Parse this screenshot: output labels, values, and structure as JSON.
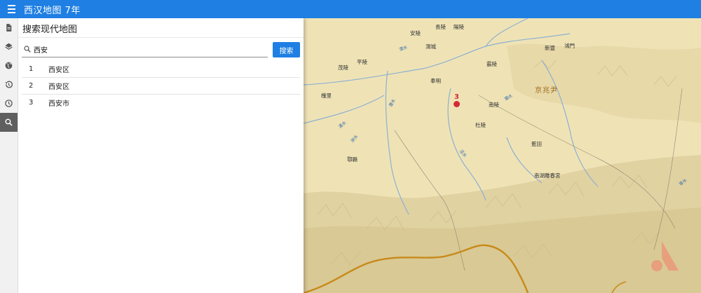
{
  "app": {
    "title": "西汉地图 7年"
  },
  "sidebar": {
    "items": [
      {
        "id": "document",
        "icon": "document-icon"
      },
      {
        "id": "layers",
        "icon": "layers-icon"
      },
      {
        "id": "globe",
        "icon": "globe-icon"
      },
      {
        "id": "history",
        "icon": "history-icon"
      },
      {
        "id": "clock",
        "icon": "clock-icon"
      },
      {
        "id": "search",
        "icon": "search-icon",
        "active": true
      }
    ]
  },
  "panel": {
    "title": "搜索现代地图",
    "search": {
      "value": "西安",
      "button_label": "搜索"
    },
    "results": [
      {
        "index": "1",
        "name": "西安区"
      },
      {
        "index": "2",
        "name": "西安区"
      },
      {
        "index": "3",
        "name": "西安市"
      }
    ]
  },
  "map": {
    "marker": {
      "label": "3",
      "color": "#d42a35"
    },
    "prefecture_label": "京兆尹",
    "place_labels": [
      "長陵",
      "陽陵",
      "安陵",
      "渭城",
      "新豐",
      "鴻門",
      "茂陵",
      "平陵",
      "霸陵",
      "槐里",
      "奉明",
      "南陵",
      "杜陵",
      "藍田",
      "鄠縣",
      "南湖離春宮"
    ],
    "river_labels": [
      "渭水",
      "灞水",
      "灃水",
      "潏水",
      "澇水",
      "涇水",
      "零水"
    ],
    "colors": {
      "plain": "#efe3b6",
      "mountain": "#e1d2a2",
      "river": "#8fb0cf",
      "boundary": "#c88a1a",
      "road": "#8a7f6a"
    }
  }
}
